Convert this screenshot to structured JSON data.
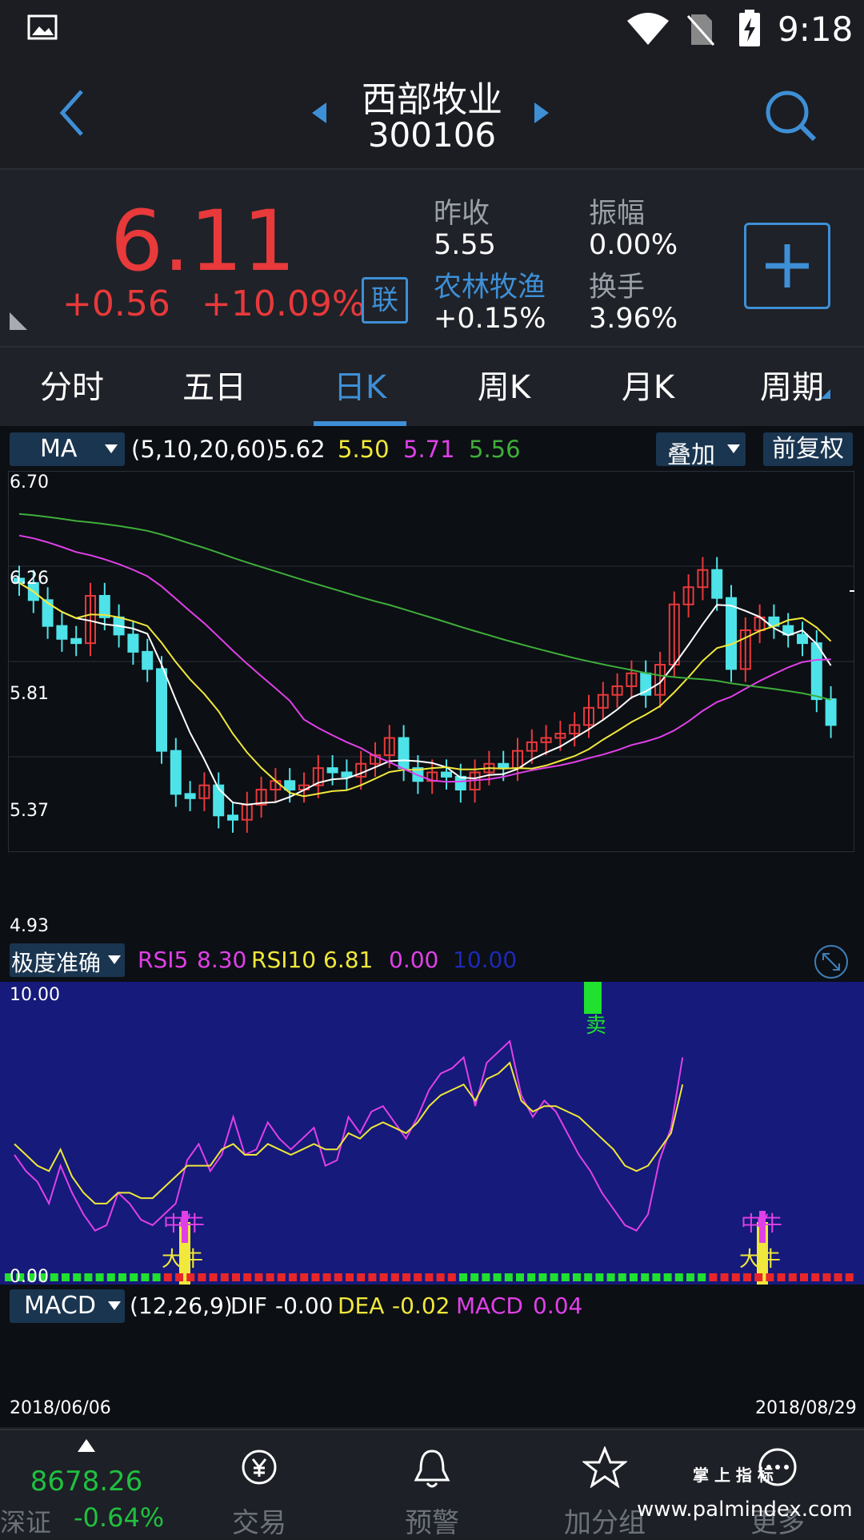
{
  "status": {
    "time": "9:18"
  },
  "header": {
    "name": "西部牧业",
    "code": "300106"
  },
  "quote": {
    "price": "6.11",
    "change": "+0.56",
    "change_pct": "+10.09%",
    "lian": "联",
    "prev_close_label": "昨收",
    "prev_close": "5.55",
    "amplitude_label": "振幅",
    "amplitude": "0.00%",
    "sector_label": "农林牧渔",
    "sector_change": "+0.15%",
    "turnover_label": "换手",
    "turnover": "3.96%"
  },
  "tabs": [
    "分时",
    "五日",
    "日K",
    "周K",
    "月K",
    "周期"
  ],
  "active_tab": 2,
  "ma": {
    "selector": "MA",
    "params": "(5,10,20,60)",
    "v5": "5.62",
    "v10": "5.50",
    "v20": "5.71",
    "v60": "5.56",
    "overlay": "叠加",
    "adjust": "前复权"
  },
  "k_axis": [
    "6.70",
    "6.26",
    "5.81",
    "5.37",
    "4.93"
  ],
  "rsi": {
    "selector": "极度准确",
    "rsi5_label": "RSI5",
    "rsi5": "8.30",
    "rsi10_label": "RSI10",
    "rsi10": "6.81",
    "low": "0.00",
    "high": "10.00",
    "axis_top": "10.00",
    "axis_bottom": "0.00",
    "sell": "卖",
    "mid_bull": "中牛",
    "big_bull": "大牛"
  },
  "macd": {
    "selector": "MACD",
    "params": "(12,26,9)",
    "dif_label": "DIF",
    "dif": "-0.00",
    "dea_label": "DEA",
    "dea": "-0.02",
    "macd_label": "MACD",
    "macd": "0.04"
  },
  "dates": {
    "start": "2018/06/06",
    "end": "2018/08/29"
  },
  "nav": {
    "index_value": "8678.26",
    "index_name": "深证",
    "index_change": "-0.64%",
    "trade": "交易",
    "alert": "预警",
    "group": "加分组",
    "more": "更多"
  },
  "watermark": "www.palmindex.com",
  "watermark_cn": "掌 上 指 标",
  "colors": {
    "up": "#e8393b",
    "down": "#4de3e8",
    "ma5": "#ffffff",
    "ma10": "#f0e83a",
    "ma20": "#e040e8",
    "ma60": "#3fae3a",
    "accent": "#3e8fd6"
  }
}
